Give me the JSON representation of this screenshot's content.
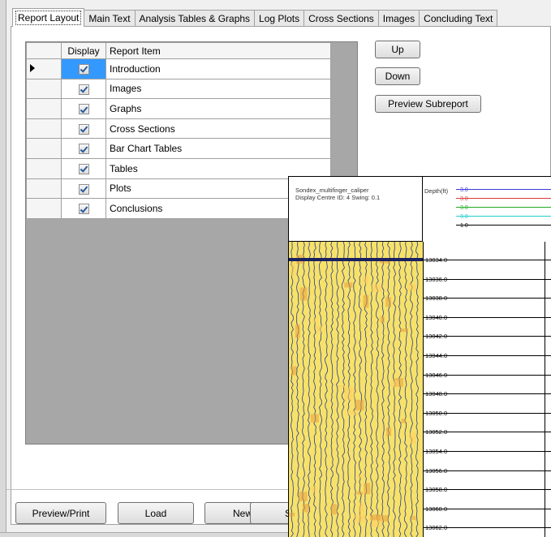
{
  "tabs": [
    {
      "label": "Report Layout",
      "active": true
    },
    {
      "label": "Main Text"
    },
    {
      "label": "Analysis Tables & Graphs"
    },
    {
      "label": "Log Plots"
    },
    {
      "label": "Cross Sections"
    },
    {
      "label": "Images"
    },
    {
      "label": "Concluding Text"
    }
  ],
  "grid": {
    "headers": {
      "display": "Display",
      "item": "Report Item"
    },
    "rows": [
      {
        "display": true,
        "label": "Introduction",
        "current": true
      },
      {
        "display": true,
        "label": "Images"
      },
      {
        "display": true,
        "label": "Graphs"
      },
      {
        "display": true,
        "label": "Cross Sections"
      },
      {
        "display": true,
        "label": "Bar Chart Tables"
      },
      {
        "display": true,
        "label": "Tables"
      },
      {
        "display": true,
        "label": "Plots"
      },
      {
        "display": true,
        "label": "Conclusions"
      }
    ]
  },
  "side_buttons": {
    "up": "Up",
    "down": "Down",
    "preview_subreport": "Preview Subreport"
  },
  "bottom_buttons": {
    "preview_print": "Preview/Print",
    "load": "Load",
    "new": "New",
    "partial": "S"
  },
  "plot": {
    "title_line1": "Sondex_multifinger_caliper",
    "title_line2": "Display Centre ID: 4   Swing: 0.1",
    "depth_label": "Depth(ft)",
    "scale_values": [
      "3.0",
      "3.0",
      "3.0",
      "3.0",
      "1.0"
    ],
    "scale_colors": [
      "#3b3bd8",
      "#d83b3b",
      "#22aa22",
      "#22cccc",
      "#000000"
    ],
    "depths": [
      "13034.0",
      "13036.0",
      "13038.0",
      "13040.0",
      "13042.0",
      "13044.0",
      "13046.0",
      "13048.0",
      "13050.0",
      "13052.0",
      "13054.0",
      "13056.0",
      "13058.0",
      "13060.0",
      "13062.0"
    ]
  }
}
